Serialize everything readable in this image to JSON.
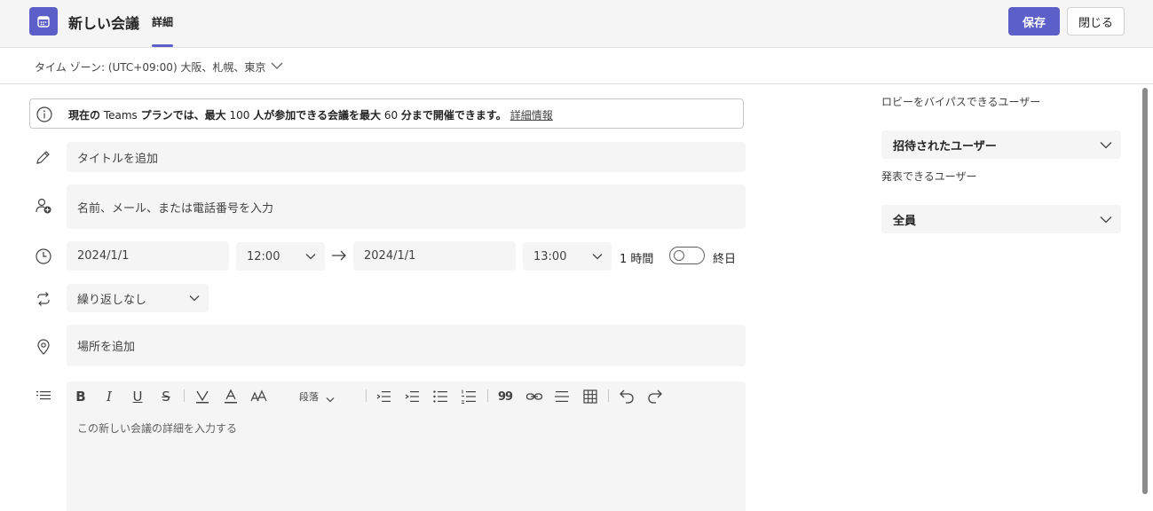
{
  "header": {
    "title": "新しい会議",
    "tab_label": "詳細",
    "save_label": "保存",
    "close_label": "閉じる"
  },
  "timezone": {
    "label": "タイム ゾーン: (UTC+09:00) 大阪、札幌、東京"
  },
  "banner": {
    "text_1": "現在の",
    "text_2": "Teams",
    "text_3": "プランでは、最大",
    "text_4": "100",
    "text_5": "人が参加できる会議を最大",
    "text_6": "60",
    "text_7": "分まで開催できます。",
    "link": "詳細情報"
  },
  "form": {
    "title_placeholder": "タイトルを追加",
    "attendees_placeholder": "名前、メール、または電話番号を入力",
    "start_date": "2024/1/1",
    "start_time": "12:00",
    "end_date": "2024/1/1",
    "end_time": "13:00",
    "duration": "1 時間",
    "all_day_label": "終日",
    "repeat": "繰り返しなし",
    "location_placeholder": "場所を追加",
    "details_placeholder": "この新しい会議の詳細を入力する"
  },
  "editor_toolbar": {
    "bold": "B",
    "italic": "I",
    "underline": "U",
    "strike": "S",
    "paragraph_label": "段落",
    "quote": "99"
  },
  "sidebar": {
    "bypass_label": "ロビーをバイパスできるユーザー",
    "bypass_value": "招待されたユーザー",
    "presenters_label": "発表できるユーザー",
    "presenters_value": "全員"
  },
  "colors": {
    "accent": "#5b5fc7",
    "field_bg": "#f5f5f5"
  }
}
